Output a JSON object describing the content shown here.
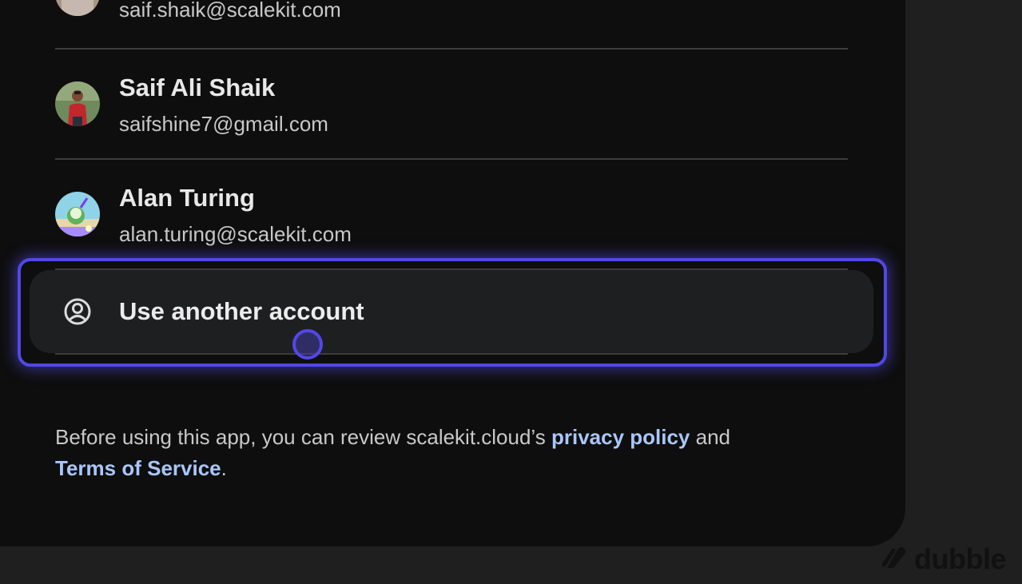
{
  "accounts": [
    {
      "name": "",
      "email": "saif.shaik@scalekit.com"
    },
    {
      "name": "Saif Ali Shaik",
      "email": "saifshine7@gmail.com"
    },
    {
      "name": "Alan Turing",
      "email": "alan.turing@scalekit.com"
    }
  ],
  "use_another_account": {
    "label": "Use another account",
    "icon": "account-circle-icon"
  },
  "footer": {
    "prefix": "Before using this app, you can review scalekit.cloud’s ",
    "privacy_link": "privacy policy",
    "middle": " and",
    "terms_link": "Terms of Service",
    "suffix": "."
  },
  "brand": {
    "name": "dubble",
    "icon": "dubble-logo-icon"
  },
  "colors": {
    "highlight": "#5248e6",
    "link": "#a8c7fa",
    "card_bg": "#0e0e0e",
    "page_bg": "#1f1f20"
  }
}
